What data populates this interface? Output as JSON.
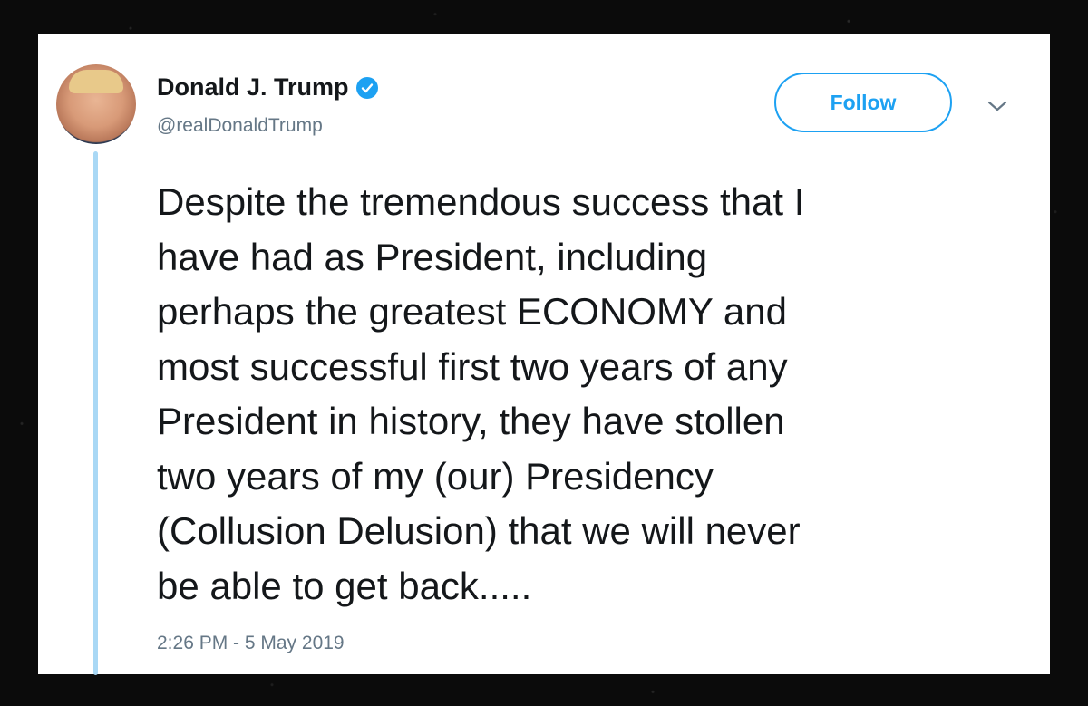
{
  "author": {
    "name": "Donald J. Trump",
    "handle": "@realDonaldTrump",
    "avatar_icon": "profile-photo",
    "verified_icon": "verified-badge-icon"
  },
  "actions": {
    "follow_label": "Follow",
    "menu_icon": "chevron-down-icon"
  },
  "tweet": {
    "text": "Despite the tremendous success that I\nhave had as President, including\nperhaps the greatest ECONOMY and\nmost successful first two years of any\nPresident in history, they have stollen\ntwo years of my (our) Presidency\n(Collusion Delusion) that we will never\nbe able to get back.....",
    "timestamp": "2:26 PM - 5 May 2019"
  },
  "colors": {
    "accent": "#1da1f2",
    "thread_line": "#a9d8f5",
    "text": "#14171a",
    "muted": "#657786",
    "background": "#0b0b0b"
  }
}
